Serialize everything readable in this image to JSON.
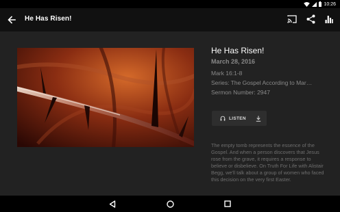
{
  "status_bar": {
    "time": "10:26",
    "icons": [
      "wifi-icon",
      "signal-icon",
      "battery-icon"
    ]
  },
  "app_bar": {
    "title": "He Has Risen!",
    "back_icon": "arrow-back-icon",
    "actions": [
      "cast-icon",
      "share-icon",
      "bar-chart-icon"
    ]
  },
  "sermon": {
    "title": "He Has Risen!",
    "date": "March 28, 2016",
    "scripture": "Mark 16:1-8",
    "series": "Series: The Gospel According to Mar…",
    "sermon_number": "Sermon Number: 2947",
    "listen_label": "LISTEN",
    "description": "The empty tomb represents the essence of the Gospel. And when a person discovers that Jesus rose from the grave, it requires a response to believe or disbelieve. On Truth For Life with Alistair Begg, we'll talk about a group of women who faced this decision on the very first Easter."
  },
  "nav_bar": {
    "buttons": [
      "back-triangle-icon",
      "home-circle-icon",
      "recents-square-icon"
    ]
  },
  "colors": {
    "app_bar": "#111111",
    "content_bg": "#222222",
    "muted_text": "#8a8a8a"
  }
}
